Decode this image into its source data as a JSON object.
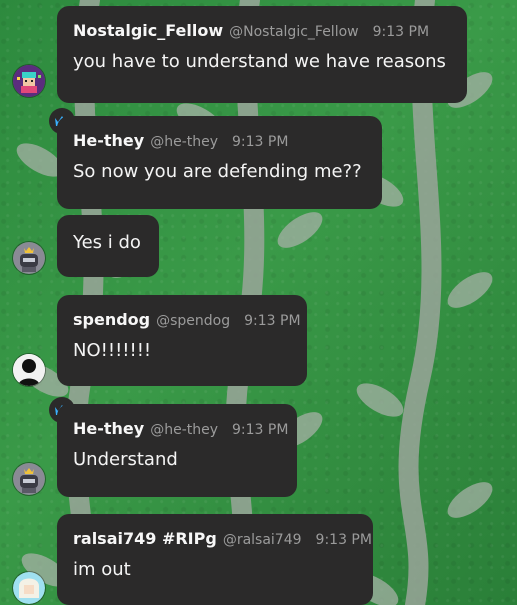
{
  "messages": [
    {
      "name": "Nostalgic_Fellow",
      "handle": "@Nostalgic_Fellow",
      "time": "9:13 PM",
      "text": "you have to understand we have reasons",
      "avatar_icon": "pixel-character-avatar-icon",
      "crown_badge": false
    },
    {
      "name": "He-they",
      "handle": "@he-they",
      "time": "9:13 PM",
      "text": "So now you are defending me??",
      "avatar_icon": "none",
      "crown_badge": true
    },
    {
      "name": "",
      "handle": "",
      "time": "",
      "text": "Yes i do",
      "avatar_icon": "robot-crown-avatar-icon",
      "crown_badge": false
    },
    {
      "name": "spendog",
      "handle": "@spendog",
      "time": "9:13 PM",
      "text": "NO!!!!!!!",
      "avatar_icon": "silhouette-avatar-icon",
      "crown_badge": false
    },
    {
      "name": "He-they",
      "handle": "@he-they",
      "time": "9:13 PM",
      "text": "Understand",
      "avatar_icon": "robot-crown-avatar-icon",
      "crown_badge": true
    },
    {
      "name": "ralsai749 #RIPg",
      "handle": "@ralsai749",
      "time": "9:13 PM",
      "text": "im out",
      "avatar_icon": "anime-character-avatar-icon",
      "crown_badge": false
    }
  ],
  "colors": {
    "bubble": "#2b2a2a",
    "name": "#f7f7f7",
    "meta": "#9b9b9b",
    "crown": "#3ab0ff",
    "background_green": "#2f8a3f"
  }
}
